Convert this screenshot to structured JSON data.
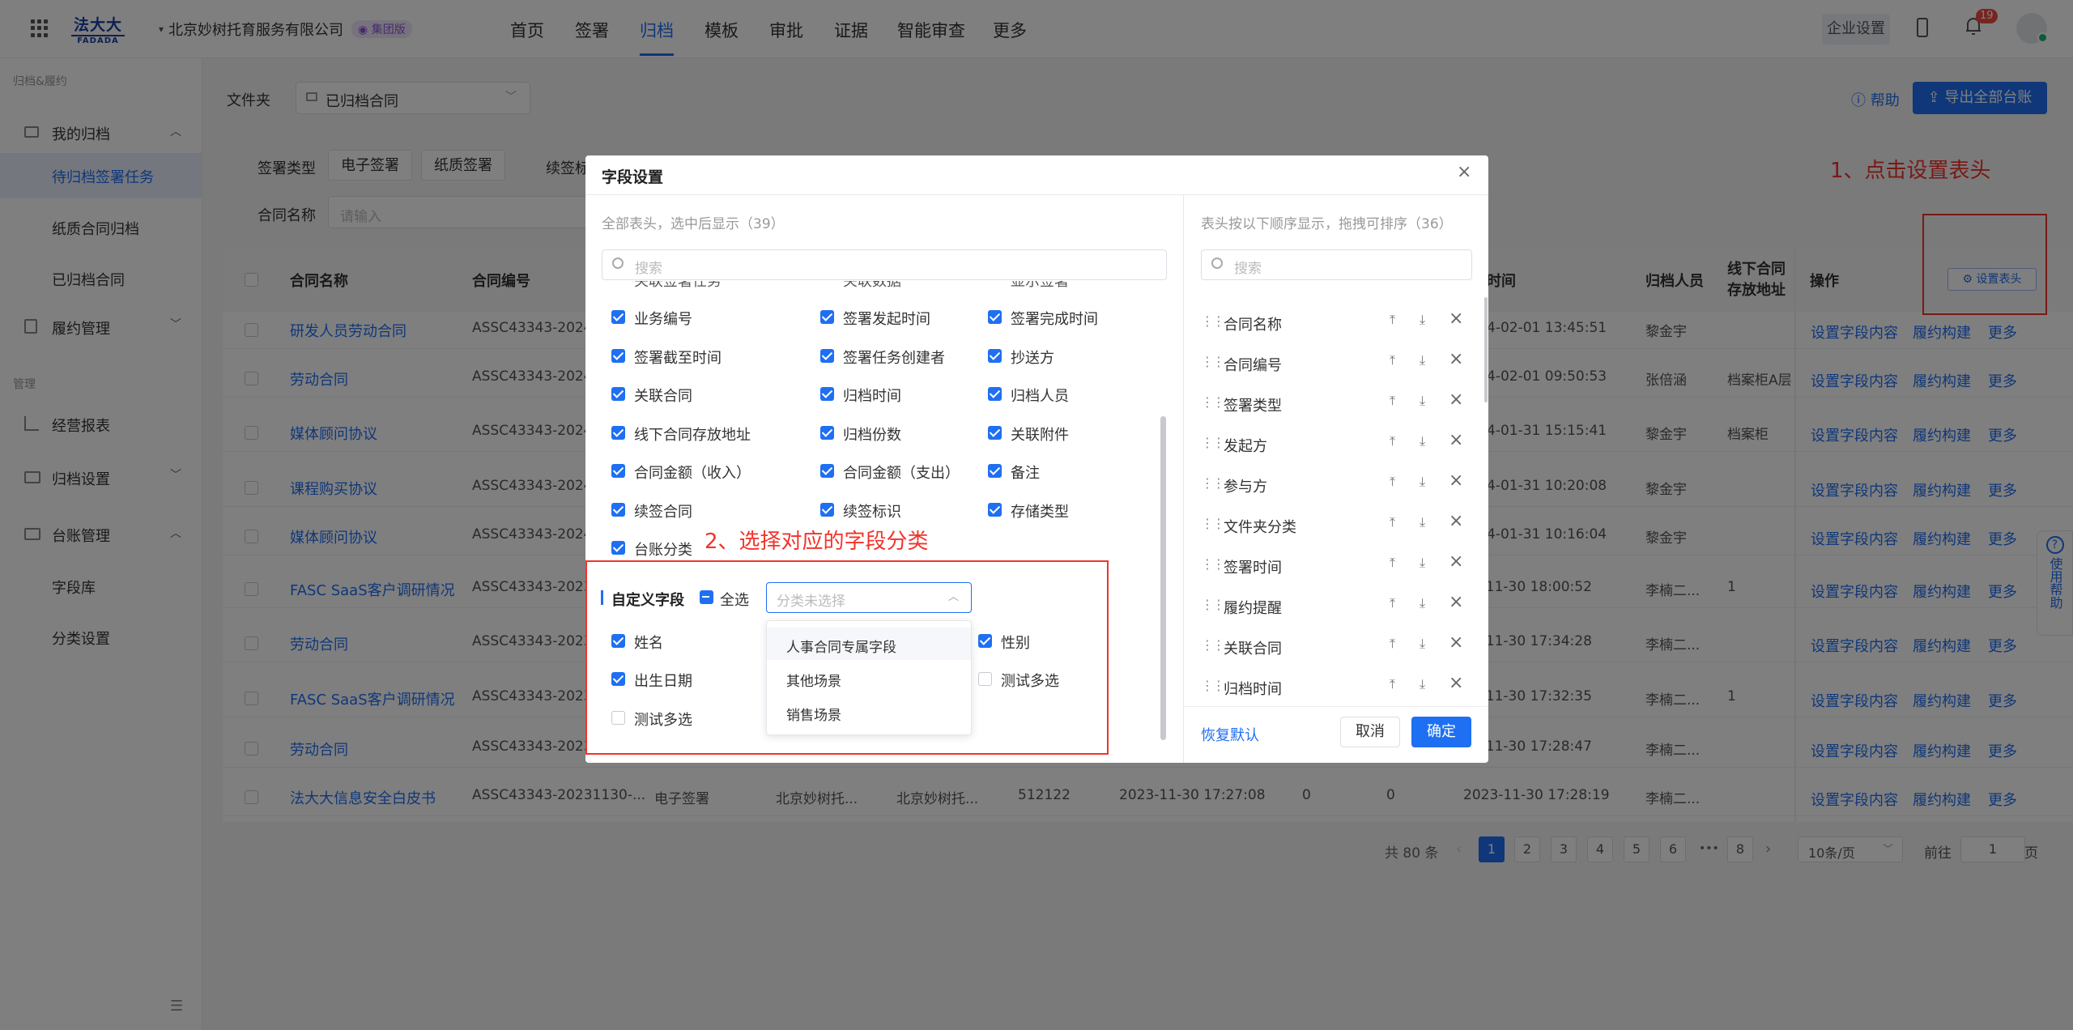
{
  "brand": {
    "logo_cn": "法大大",
    "logo_en": "FADADA"
  },
  "company": {
    "name": "北京妙树托育服务有限公司",
    "badge": "集团版"
  },
  "nav": [
    "首页",
    "签署",
    "归档",
    "模板",
    "审批",
    "证据",
    "智能审查",
    "更多"
  ],
  "top_right": {
    "enterprise_settings": "企业设置",
    "notification_count": "19"
  },
  "sidebar": {
    "section1": "归档&履约",
    "my_archive": "我的归档",
    "my_archive_items": [
      "待归档签署任务",
      "纸质合同归档",
      "已归档合同"
    ],
    "perf": "履约管理",
    "section2": "管理",
    "items": [
      "经营报表",
      "归档设置",
      "台账管理"
    ],
    "ledger_items": [
      "字段库",
      "分类设置"
    ]
  },
  "filters": {
    "folder_label": "文件夹",
    "folder_value": "已归档合同",
    "sign_type_label": "签署类型",
    "sign_type_tags": [
      "电子签署",
      "纸质签署"
    ],
    "renew_label": "续签标",
    "name_label": "合同名称",
    "name_placeholder": "请输入"
  },
  "actions": {
    "help": "帮助",
    "export": "导出全部台账"
  },
  "annotations": {
    "step1": "1、点击设置表头",
    "step2": "2、选择对应的字段分类"
  },
  "table": {
    "headers": {
      "name": "合同名称",
      "number": "合同编号",
      "time": "时间",
      "person": "归档人员",
      "offline": "线下合同存放地址",
      "ops": "操作",
      "settings_btn": "设置表头"
    },
    "rows": [
      {
        "name": "研发人员劳动合同",
        "number": "ASSC43343-20240",
        "time": "4-02-01 13:45:51",
        "person": "黎金宇",
        "offline": ""
      },
      {
        "name": "劳动合同",
        "number": "ASSC43343-20240",
        "time": "4-02-01 09:50:53",
        "person": "张倍涵",
        "offline": "档案柜A层"
      },
      {
        "name": "媒体顾问协议",
        "number": "ASSC43343-20240",
        "time": "4-01-31 15:15:41",
        "person": "黎金宇",
        "offline": "档案柜"
      },
      {
        "name": "课程购买协议",
        "number": "ASSC43343-20240",
        "time": "4-01-31 10:20:08",
        "person": "黎金宇",
        "offline": ""
      },
      {
        "name": "媒体顾问协议",
        "number": "ASSC43343-20240",
        "time": "4-01-31 10:16:04",
        "person": "黎金宇",
        "offline": ""
      },
      {
        "name": "FASC SaaS客户调研情况",
        "number": "ASSC43343-20231",
        "time": "23-11-30 18:00:52",
        "person": "李楠二...",
        "offline": "1"
      },
      {
        "name": "劳动合同",
        "number": "ASSC43343-20231",
        "time": "23-11-30 17:34:28",
        "person": "李楠二...",
        "offline": ""
      },
      {
        "name": "FASC SaaS客户调研情况",
        "number": "ASSC43343-20231",
        "time": "23-11-30 17:32:35",
        "person": "李楠二...",
        "offline": "1"
      },
      {
        "name": "劳动合同",
        "number": "ASSC43343-20231",
        "time": "23-11-30 17:28:47",
        "person": "李楠二...",
        "offline": ""
      },
      {
        "name": "法大大信息安全白皮书",
        "number": "ASSC43343-20231130-...",
        "time": "2023-11-30 17:28:19",
        "person": "李楠二...",
        "offline": ""
      }
    ],
    "last_row_extra": {
      "type": "电子签署",
      "a": "北京妙树托...",
      "b": "北京妙树托...",
      "num": "512122",
      "date": "2023-11-30 17:27:08",
      "c": "0",
      "d": "0"
    },
    "row_actions": [
      "设置字段内容",
      "履约构建",
      "更多"
    ]
  },
  "pagination": {
    "total": "共 80 条",
    "pages": [
      "1",
      "2",
      "3",
      "4",
      "5",
      "6",
      "8"
    ],
    "ellipsis": "•••",
    "page_size": "10条/页",
    "goto_label": "前往",
    "goto_value": "1",
    "page_suffix": "页"
  },
  "help_float": "使用帮助",
  "modal": {
    "title": "字段设置",
    "left_title": "全部表头，选中后显示（39）",
    "search_placeholder": "搜索",
    "top_partial": [
      "关联签署任务",
      "关联数据",
      "显示签署"
    ],
    "fields": [
      [
        "业务编号",
        "签署发起时间",
        "签署完成时间"
      ],
      [
        "签署截至时间",
        "签署任务创建者",
        "抄送方"
      ],
      [
        "关联合同",
        "归档时间",
        "归档人员"
      ],
      [
        "线下合同存放地址",
        "归档份数",
        "关联附件"
      ],
      [
        "合同金额（收入）",
        "合同金额（支出）",
        "备注"
      ],
      [
        "续签合同",
        "续签标识",
        "存储类型"
      ],
      [
        "台账分类"
      ]
    ],
    "custom": {
      "title": "自定义字段",
      "select_all": "全选",
      "select_placeholder": "分类未选择",
      "fields": [
        {
          "label": "姓名",
          "checked": true
        },
        {
          "label": "性别",
          "checked": true
        },
        {
          "label": "出生日期",
          "checked": true
        },
        {
          "label": "测试多选",
          "checked": false
        },
        {
          "label": "测试多选",
          "checked": false
        }
      ]
    },
    "dropdown": [
      "人事合同专属字段",
      "其他场景",
      "销售场景"
    ],
    "right_title": "表头按以下顺序显示，拖拽可排序（36）",
    "right_fields": [
      "合同名称",
      "合同编号",
      "签署类型",
      "发起方",
      "参与方",
      "文件夹分类",
      "签署时间",
      "履约提醒",
      "关联合同",
      "归档时间"
    ],
    "restore": "恢复默认",
    "cancel": "取消",
    "confirm": "确定"
  }
}
